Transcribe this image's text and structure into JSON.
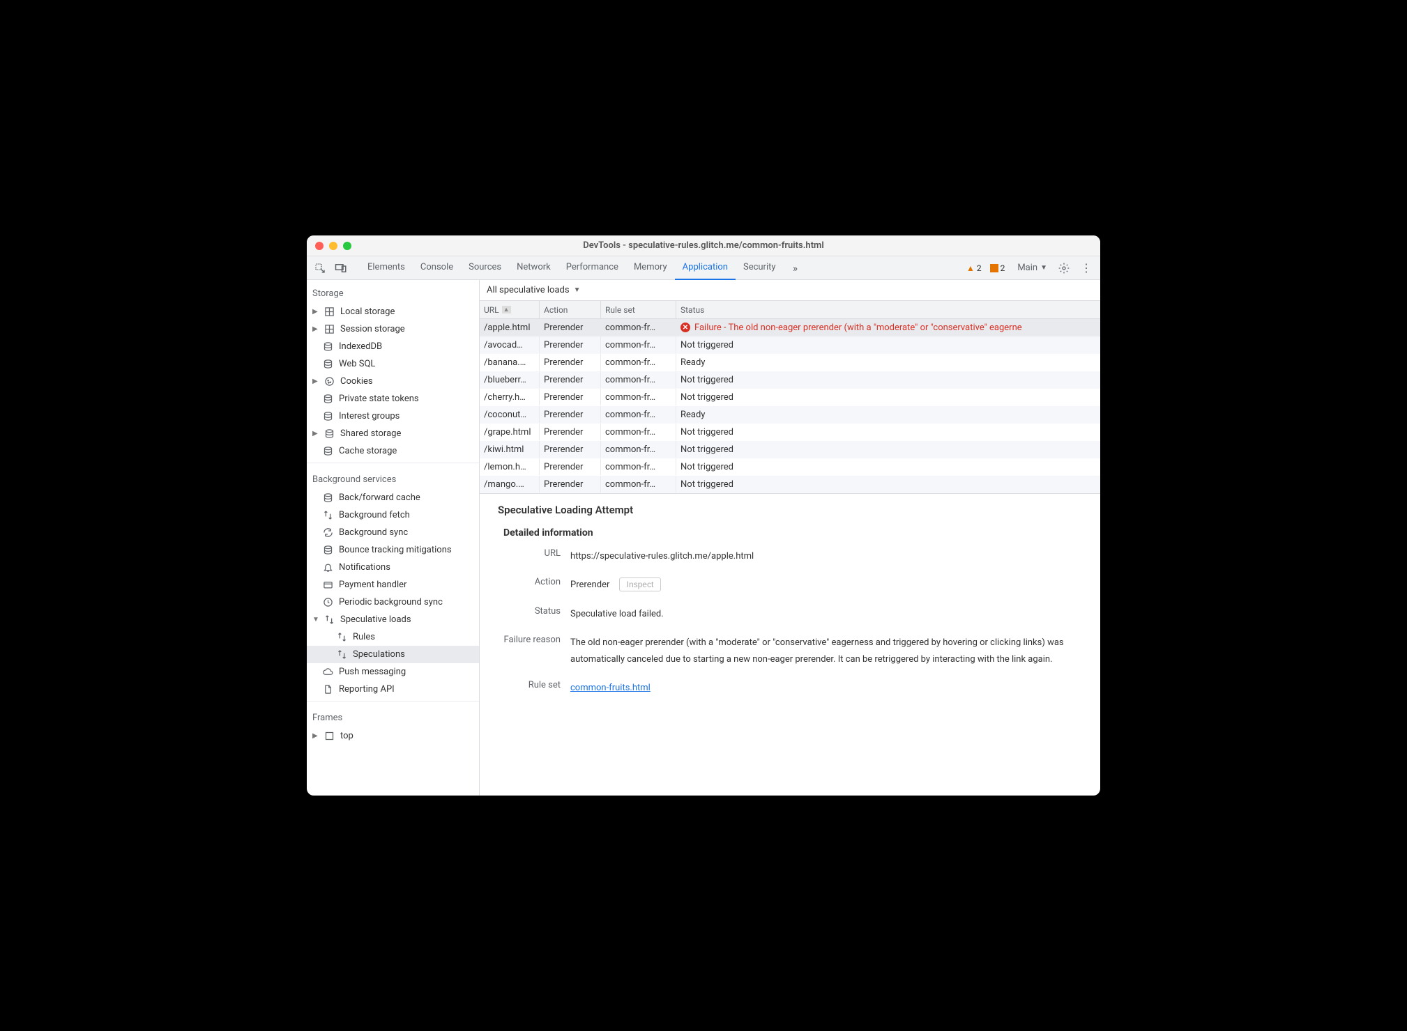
{
  "window_title": "DevTools - speculative-rules.glitch.me/common-fruits.html",
  "tabs": [
    "Elements",
    "Console",
    "Sources",
    "Network",
    "Performance",
    "Memory",
    "Application",
    "Security"
  ],
  "active_tab": "Application",
  "warning_count": "2",
  "info_count": "2",
  "main_label": "Main",
  "sidebar": {
    "storage_title": "Storage",
    "storage_items": [
      {
        "label": "Local storage",
        "icon": "grid",
        "arrow": true
      },
      {
        "label": "Session storage",
        "icon": "grid",
        "arrow": true
      },
      {
        "label": "IndexedDB",
        "icon": "db"
      },
      {
        "label": "Web SQL",
        "icon": "db"
      },
      {
        "label": "Cookies",
        "icon": "cookie",
        "arrow": true
      },
      {
        "label": "Private state tokens",
        "icon": "db"
      },
      {
        "label": "Interest groups",
        "icon": "db"
      },
      {
        "label": "Shared storage",
        "icon": "db",
        "arrow": true
      },
      {
        "label": "Cache storage",
        "icon": "db"
      }
    ],
    "bg_title": "Background services",
    "bg_items": [
      {
        "label": "Back/forward cache",
        "icon": "db"
      },
      {
        "label": "Background fetch",
        "icon": "updown"
      },
      {
        "label": "Background sync",
        "icon": "sync"
      },
      {
        "label": "Bounce tracking mitigations",
        "icon": "db"
      },
      {
        "label": "Notifications",
        "icon": "bell"
      },
      {
        "label": "Payment handler",
        "icon": "card"
      },
      {
        "label": "Periodic background sync",
        "icon": "clock"
      },
      {
        "label": "Speculative loads",
        "icon": "updown",
        "arrow": true,
        "expanded": true,
        "children": [
          {
            "label": "Rules",
            "icon": "updown"
          },
          {
            "label": "Speculations",
            "icon": "updown",
            "selected": true
          }
        ]
      },
      {
        "label": "Push messaging",
        "icon": "cloud"
      },
      {
        "label": "Reporting API",
        "icon": "doc"
      }
    ],
    "frames_title": "Frames",
    "frames_items": [
      {
        "label": "top",
        "icon": "frame",
        "arrow": true
      }
    ]
  },
  "filter_label": "All speculative loads",
  "columns": {
    "url": "URL",
    "action": "Action",
    "ruleset": "Rule set",
    "status": "Status"
  },
  "rows": [
    {
      "url": "/apple.html",
      "action": "Prerender",
      "ruleset": "common-fr…",
      "status": "Failure - The old non-eager prerender (with a \"moderate\" or \"conservative\" eagerne",
      "fail": true,
      "selected": true
    },
    {
      "url": "/avocad…",
      "action": "Prerender",
      "ruleset": "common-fr…",
      "status": "Not triggered"
    },
    {
      "url": "/banana.…",
      "action": "Prerender",
      "ruleset": "common-fr…",
      "status": "Ready"
    },
    {
      "url": "/blueberr…",
      "action": "Prerender",
      "ruleset": "common-fr…",
      "status": "Not triggered"
    },
    {
      "url": "/cherry.h…",
      "action": "Prerender",
      "ruleset": "common-fr…",
      "status": "Not triggered"
    },
    {
      "url": "/coconut…",
      "action": "Prerender",
      "ruleset": "common-fr…",
      "status": "Ready"
    },
    {
      "url": "/grape.html",
      "action": "Prerender",
      "ruleset": "common-fr…",
      "status": "Not triggered"
    },
    {
      "url": "/kiwi.html",
      "action": "Prerender",
      "ruleset": "common-fr…",
      "status": "Not triggered"
    },
    {
      "url": "/lemon.h…",
      "action": "Prerender",
      "ruleset": "common-fr…",
      "status": "Not triggered"
    },
    {
      "url": "/mango.…",
      "action": "Prerender",
      "ruleset": "common-fr…",
      "status": "Not triggered"
    }
  ],
  "details": {
    "heading": "Speculative Loading Attempt",
    "section": "Detailed information",
    "url_label": "URL",
    "url_value": "https://speculative-rules.glitch.me/apple.html",
    "action_label": "Action",
    "action_value": "Prerender",
    "inspect_label": "Inspect",
    "status_label": "Status",
    "status_value": "Speculative load failed.",
    "reason_label": "Failure reason",
    "reason_value": "The old non-eager prerender (with a \"moderate\" or \"conservative\" eagerness and triggered by hovering or clicking links) was automatically canceled due to starting a new non-eager prerender. It can be retriggered by interacting with the link again.",
    "ruleset_label": "Rule set",
    "ruleset_value": "common-fruits.html"
  }
}
